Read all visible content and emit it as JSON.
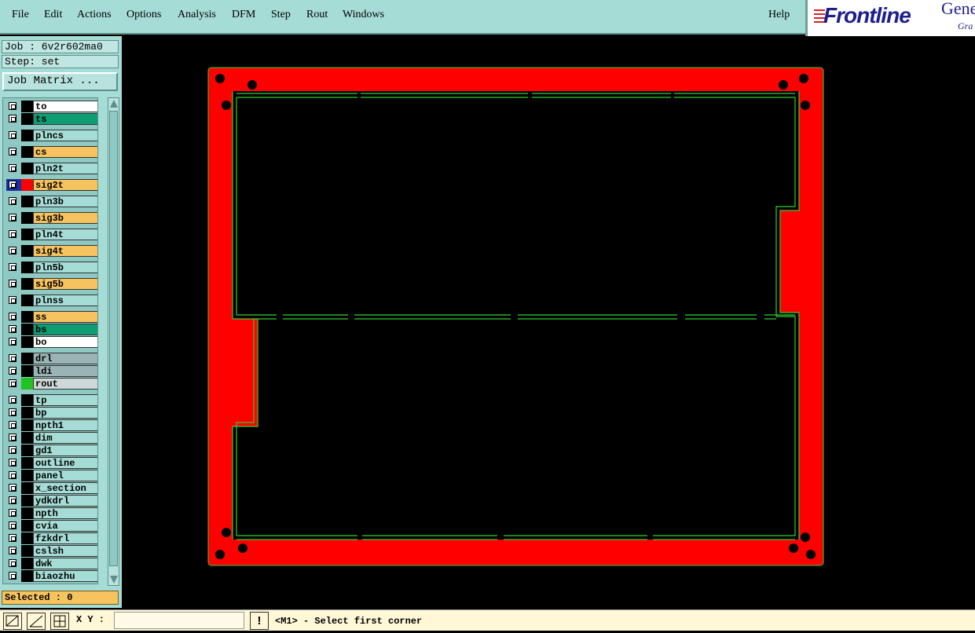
{
  "menu": {
    "file": "File",
    "edit": "Edit",
    "actions": "Actions",
    "options": "Options",
    "analysis": "Analysis",
    "dfm": "DFM",
    "step": "Step",
    "rout": "Rout",
    "windows": "Windows",
    "help": "Help"
  },
  "logo": {
    "brand": "Frontline",
    "product": "Gene",
    "sub": "Gra"
  },
  "job": {
    "label": "Job : 6v2r602ma0",
    "step": "Step: set",
    "matrix_button": "Job Matrix ..."
  },
  "layers": [
    {
      "name": "to",
      "bg": "#ffffff"
    },
    {
      "name": "ts",
      "bg": "#0e9c74"
    },
    {
      "name": "plncs",
      "bg": "#a6dcd6"
    },
    {
      "name": "cs",
      "bg": "#f7c35f"
    },
    {
      "name": "pln2t",
      "bg": "#a6dcd6"
    },
    {
      "name": "sig2t",
      "bg": "#f7c35f",
      "active": true
    },
    {
      "name": "pln3b",
      "bg": "#a6dcd6"
    },
    {
      "name": "sig3b",
      "bg": "#f7c35f"
    },
    {
      "name": "pln4t",
      "bg": "#a6dcd6"
    },
    {
      "name": "sig4t",
      "bg": "#f7c35f"
    },
    {
      "name": "pln5b",
      "bg": "#a6dcd6"
    },
    {
      "name": "sig5b",
      "bg": "#f7c35f"
    },
    {
      "name": "plnss",
      "bg": "#a6dcd6"
    },
    {
      "name": "ss",
      "bg": "#f7c35f"
    },
    {
      "name": "bs",
      "bg": "#0e9c74"
    },
    {
      "name": "bo",
      "bg": "#ffffff"
    },
    {
      "name": "drl",
      "bg": "#9ab3b4"
    },
    {
      "name": "ldi",
      "bg": "#9ab3b4"
    },
    {
      "name": "rout",
      "bg": "#cfd8d8",
      "routcolor": true
    },
    {
      "name": "tp",
      "bg": "#a6dcd6"
    },
    {
      "name": "bp",
      "bg": "#a6dcd6"
    },
    {
      "name": "npth1",
      "bg": "#a6dcd6"
    },
    {
      "name": "dim",
      "bg": "#a6dcd6"
    },
    {
      "name": "gd1",
      "bg": "#a6dcd6"
    },
    {
      "name": "outline",
      "bg": "#a6dcd6"
    },
    {
      "name": "panel",
      "bg": "#a6dcd6"
    },
    {
      "name": "x_section",
      "bg": "#a6dcd6"
    },
    {
      "name": "ydkdrl",
      "bg": "#a6dcd6"
    },
    {
      "name": "npth",
      "bg": "#a6dcd6"
    },
    {
      "name": "cvia",
      "bg": "#a6dcd6"
    },
    {
      "name": "fzkdrl",
      "bg": "#a6dcd6"
    },
    {
      "name": "cslsh",
      "bg": "#a6dcd6"
    },
    {
      "name": "dwk",
      "bg": "#a6dcd6"
    },
    {
      "name": "biaozhu",
      "bg": "#a6dcd6"
    }
  ],
  "selected": "Selected : 0",
  "status": {
    "xy_label": "X Y :",
    "xy_value": "",
    "warning": "!",
    "prompt": "<M1> - Select first corner"
  },
  "colors": {
    "board": "#ff0000",
    "outline": "#33cc33",
    "menu_bg": "#a6dcd6"
  }
}
